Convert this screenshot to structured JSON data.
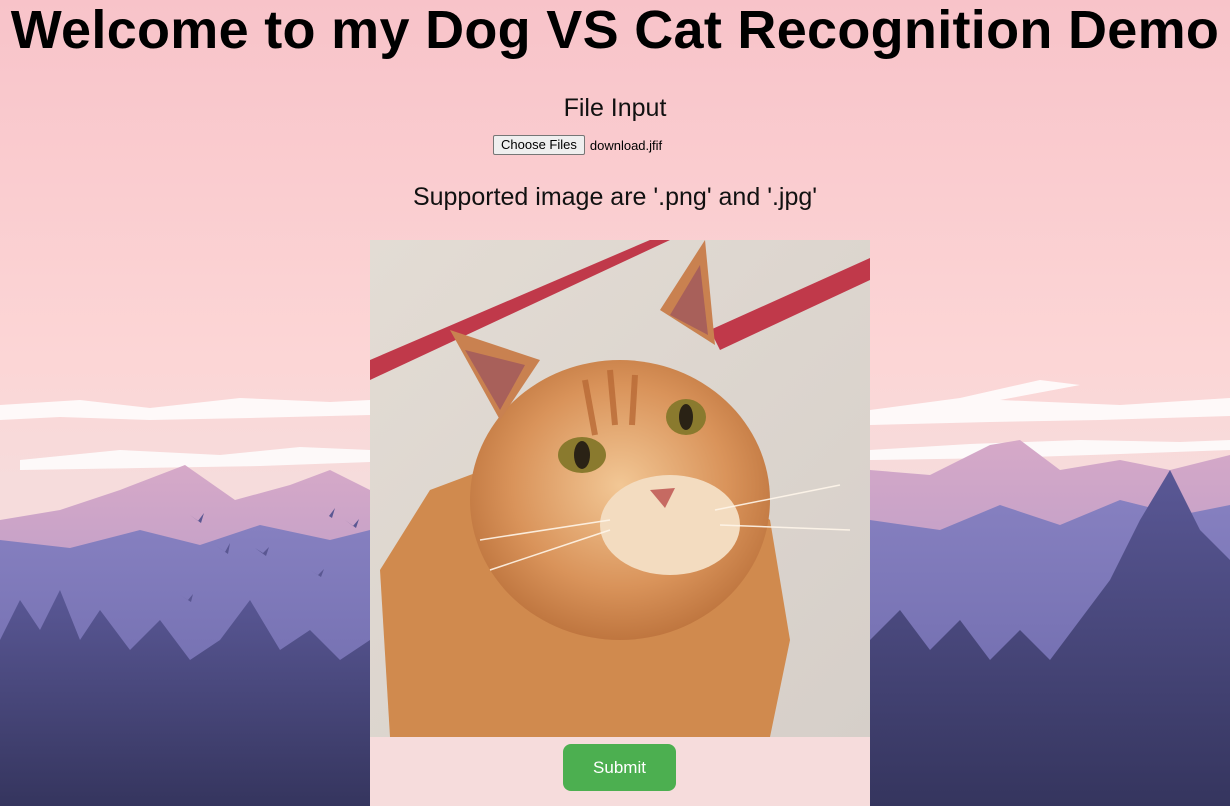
{
  "page": {
    "title": "Welcome to my Dog VS Cat Recognition Demo"
  },
  "file_input": {
    "label": "File Input",
    "button_label": "Choose Files",
    "selected_file": "download.jfif"
  },
  "supported_text": "Supported image are '.png' and '.jpg'",
  "preview": {
    "subject": "orange tabby cat photo"
  },
  "submit_label": "Submit",
  "colors": {
    "sky_top": "#f9c8cc",
    "mountains": "#8c86c4",
    "forest": "#4a4a80",
    "submit": "#4caf50"
  }
}
